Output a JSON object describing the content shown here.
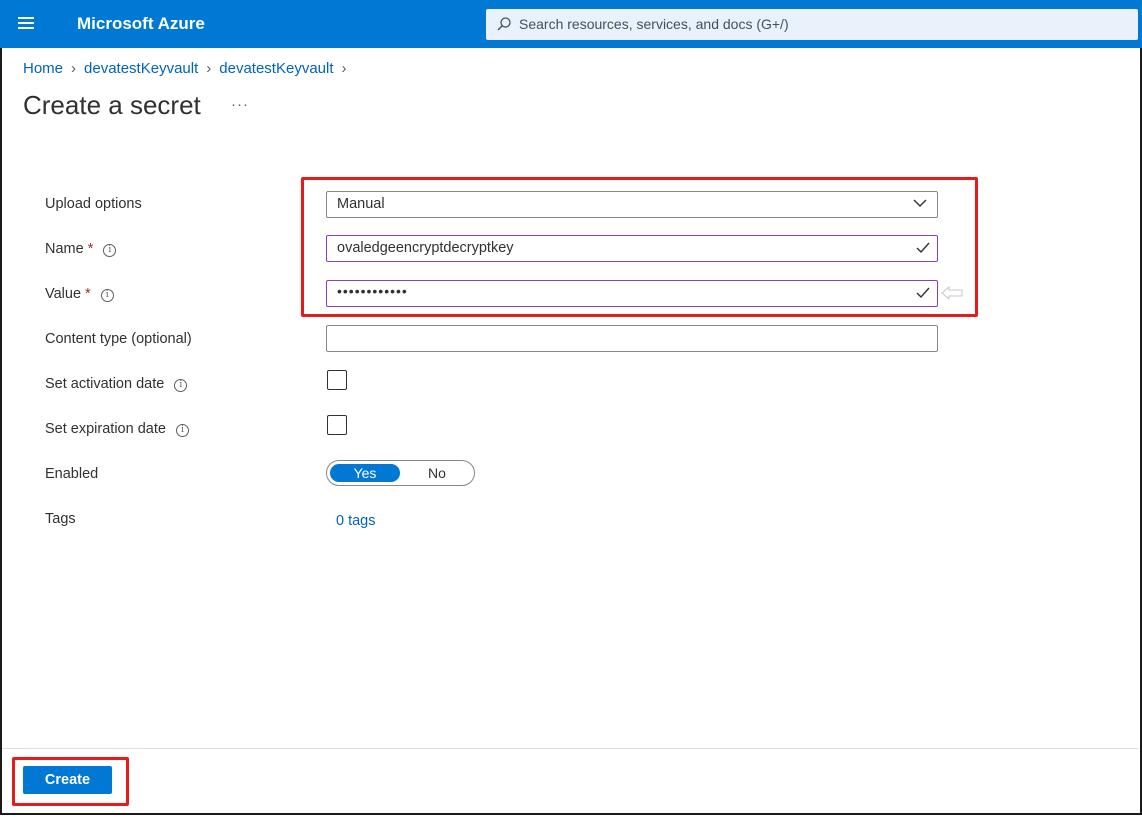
{
  "header": {
    "brand": "Microsoft Azure",
    "search_placeholder": "Search resources, services, and docs (G+/)"
  },
  "breadcrumb": [
    "Home",
    "devatestKeyvault",
    "devatestKeyvault"
  ],
  "page": {
    "title": "Create a secret",
    "more": "···"
  },
  "form": {
    "upload_options": {
      "label": "Upload options",
      "value": "Manual"
    },
    "name": {
      "label": "Name",
      "required": "*",
      "value": "ovaledgeencryptdecryptkey"
    },
    "value": {
      "label": "Value",
      "required": "*",
      "value": "••••••••••••"
    },
    "content_type": {
      "label": "Content type (optional)",
      "value": ""
    },
    "activation": {
      "label": "Set activation date"
    },
    "expiration": {
      "label": "Set expiration date"
    },
    "enabled": {
      "label": "Enabled",
      "yes": "Yes",
      "no": "No",
      "selected": "Yes"
    },
    "tags": {
      "label": "Tags",
      "link": "0 tags"
    }
  },
  "footer": {
    "create_label": "Create"
  },
  "colors": {
    "accent": "#0078d4",
    "highlight": "#e81b1b",
    "valid_border": "#8a3fb8"
  },
  "icons": {
    "menu": "hamburger-icon",
    "search": "search-icon",
    "chevron": "chevron-down-icon",
    "check": "check-icon",
    "info": "info-icon"
  }
}
